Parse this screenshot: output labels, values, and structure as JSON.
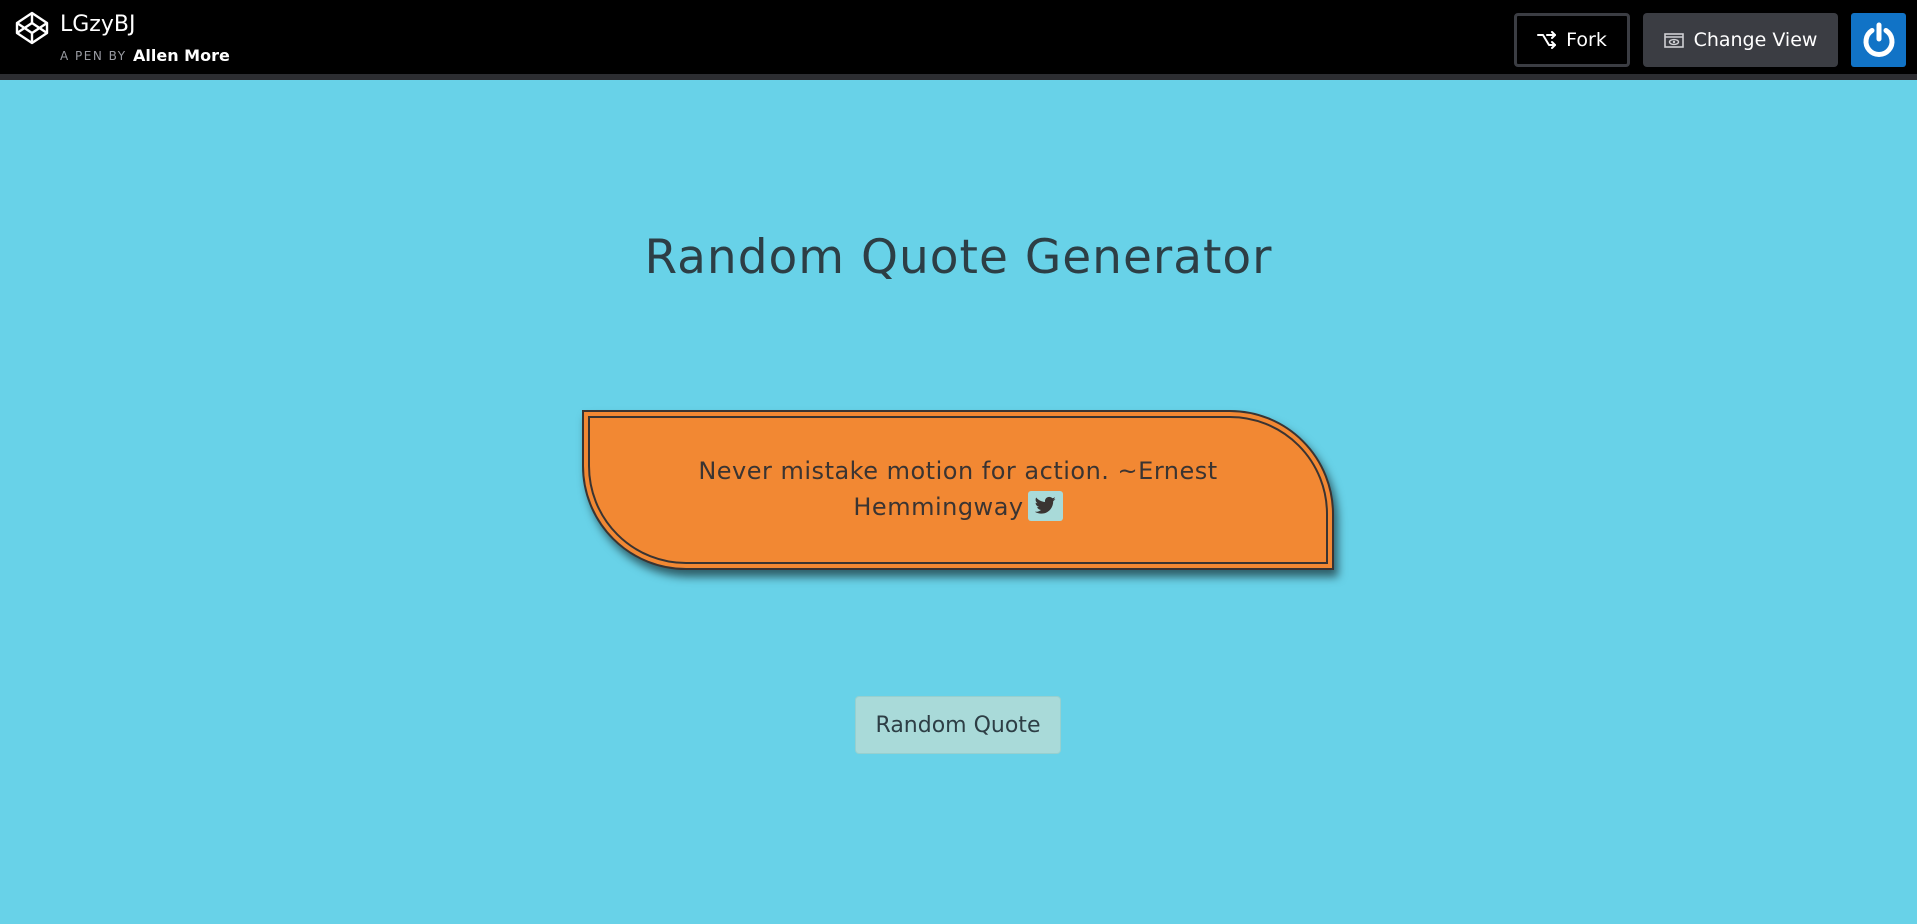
{
  "header": {
    "logo_icon": "codepen-logo-icon",
    "pen_title": "LGzyBJ",
    "pen_by_label": "A PEN BY",
    "author": "Allen More",
    "fork_label": "Fork",
    "fork_icon": "fork-icon",
    "change_view_label": "Change View",
    "change_view_icon": "eye-window-icon",
    "power_icon": "power-icon",
    "power_color": "#1173c6"
  },
  "main": {
    "title": "Random Quote Generator",
    "quote": {
      "text": "Never mistake motion for action. ~Ernest Hemmingway",
      "tweet_icon": "twitter-icon",
      "card_color": "#f28833"
    },
    "random_button_label": "Random Quote",
    "background_color": "#68d2e8"
  }
}
